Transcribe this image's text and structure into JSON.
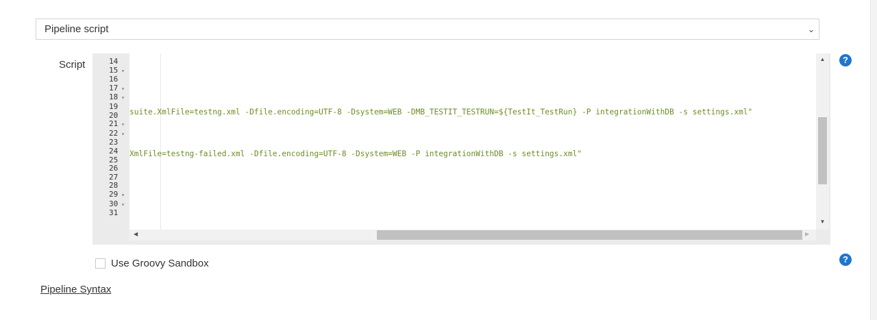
{
  "definition": {
    "selected": "Pipeline script",
    "chevron_icon": "chevron-down-icon"
  },
  "script": {
    "label": "Script",
    "line_numbers": [
      "14",
      "15",
      "16",
      "17",
      "18",
      "19",
      "20",
      "21",
      "22",
      "23",
      "24",
      "25",
      "26",
      "27",
      "28",
      "29",
      "30",
      "31"
    ],
    "fold_lines": [
      "15",
      "17",
      "18",
      "21",
      "22",
      "29",
      "30"
    ],
    "code_lines": [
      "suite.XmlFile=testng.xml -Dfile.encoding=UTF-8 -Dsystem=WEB -DMB_TESTIT_TESTRUN=${TestIt_TestRun} -P integrationWithDB -s settings.xml\"",
      "XmlFile=testng-failed.xml -Dfile.encoding=UTF-8 -Dsystem=WEB -P integrationWithDB -s settings.xml\""
    ]
  },
  "help": {
    "symbol": "?"
  },
  "sandbox": {
    "label": "Use Groovy Sandbox",
    "checked": false
  },
  "pipeline_syntax": {
    "label": "Pipeline Syntax"
  },
  "colors": {
    "code": "#6b8e23",
    "help": "#1f75cc"
  }
}
